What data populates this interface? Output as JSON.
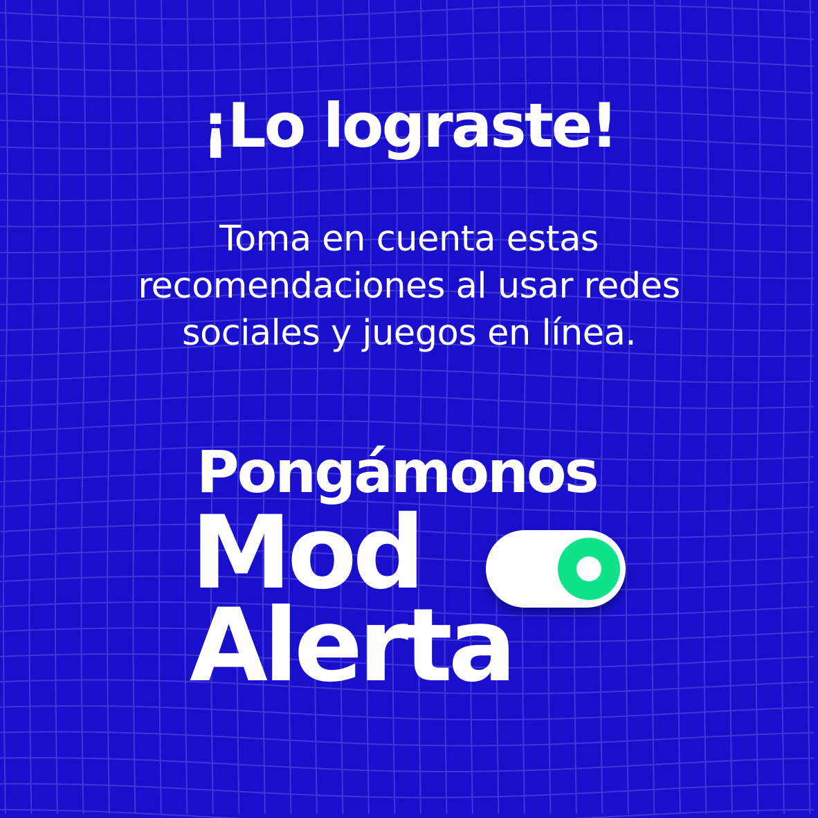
{
  "headline": "¡Lo lograste!",
  "body": {
    "line1": "Toma en cuenta estas",
    "line2": "recomendaciones al usar redes",
    "line3": "sociales y juegos en línea."
  },
  "logo": {
    "line1": "Pongámonos",
    "line2": "Mod",
    "line3": "Alerta",
    "toggle_icon": "toggle-switch-on-icon"
  },
  "colors": {
    "background": "#1a10cc",
    "grid": "#4a44dc",
    "text": "#ffffff",
    "toggle_knob": "#10e28a"
  }
}
